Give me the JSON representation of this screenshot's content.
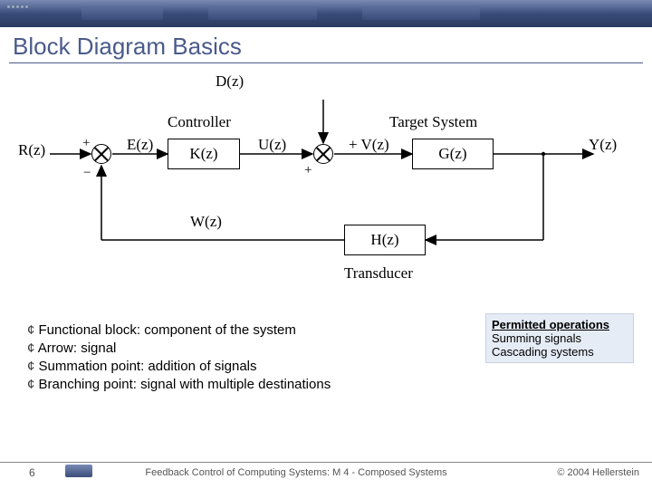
{
  "title": "Block Diagram Basics",
  "diagram": {
    "disturbance": "D(z)",
    "controller_label": "Controller",
    "target_label": "Target System",
    "signals": {
      "R": "R(z)",
      "E": "E(z)",
      "U": "U(z)",
      "V": "+ V(z)",
      "Y": "Y(z)",
      "W": "W(z)"
    },
    "blocks": {
      "K": "K(z)",
      "G": "G(z)",
      "H": "H(z)"
    },
    "sum1": {
      "plus": "+",
      "minus": "−"
    },
    "sum2": {
      "plus": "+"
    },
    "transducer_label": "Transducer"
  },
  "bullets": [
    "Functional block: component of the system",
    "Arrow: signal",
    "Summation point: addition of signals",
    "Branching point: signal with multiple destinations"
  ],
  "permitted": {
    "title": "Permitted operations",
    "line1": "Summing signals",
    "line2": "Cascading systems"
  },
  "footer": {
    "slide": "6",
    "center": "Feedback Control of Computing Systems: M 4 - Composed Systems",
    "right": "© 2004 Hellerstein"
  }
}
